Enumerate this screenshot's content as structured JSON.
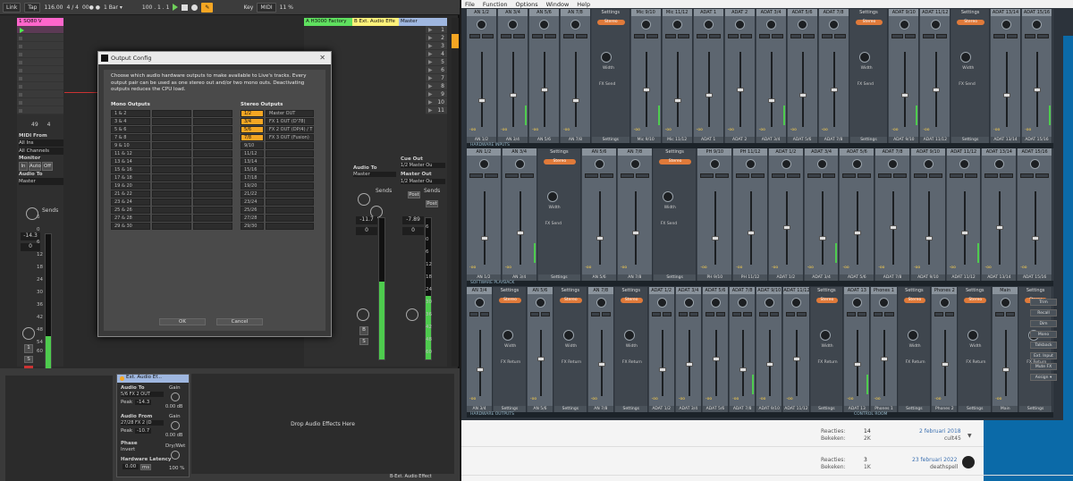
{
  "ableton": {
    "toolbar": {
      "link": "Link",
      "tap": "Tap",
      "bpm": "116.00",
      "meter": "4 / 4",
      "metro": "00● ●",
      "quantize": "1 Bar ▾",
      "position": "100 .  1 .  1",
      "key": "Key",
      "midi": "MIDI",
      "cpu": "11 %"
    },
    "tracks": [
      {
        "name": "1 SQ80 V",
        "color": "#ff66cc"
      },
      {
        "name": "A H3000 Factory",
        "color": "#5fe05f"
      },
      {
        "name": "B Ext. Audio Effe",
        "color": "#fff27a"
      },
      {
        "name": "Master",
        "color": "#9fb7e0"
      }
    ],
    "scenes": [
      "1",
      "2",
      "3",
      "4",
      "5",
      "6",
      "7",
      "8",
      "9",
      "10",
      "11"
    ],
    "io": {
      "midi_from": "MIDI From",
      "all_ins": "All Ins",
      "all_channels": "All Channels",
      "monitor": "Monitor",
      "mon_in": "In",
      "mon_auto": "Auto",
      "mon_off": "Off",
      "audio_to": "Audio To",
      "master": "Master",
      "sends": "Sends",
      "cue_out": "Cue Out",
      "cue_out_val": "1/2 Master Ou",
      "master_out": "Master Out",
      "master_out_val": "1/2 Master Ou",
      "post": "Post"
    },
    "volumes": {
      "t1": "-14.3",
      "t1b": "0",
      "a": "-11.7",
      "ab": "0",
      "m": "-7.89",
      "mb": "0"
    },
    "meter_ticks": [
      "6",
      "0",
      "6",
      "12",
      "18",
      "24",
      "30",
      "36",
      "42",
      "48",
      "54",
      "60"
    ],
    "track_buttons": {
      "t1_num": "1",
      "t1_s": "S",
      "ta": "A",
      "tb": "B"
    },
    "clip_counters": {
      "a": "49",
      "b": "4"
    },
    "device": {
      "title": "Ext. Audio Ef...",
      "audio_to": "Audio To",
      "audio_to_val": "5/6 FX 2 OUT",
      "gain": "Gain",
      "gain_val1": "0.00 dB",
      "peak": "Peak",
      "peak_val1": "-14.3",
      "audio_from": "Audio From",
      "audio_from_val": "27/28 FX 2 (D",
      "gain_val2": "0.00 dB",
      "peak_val2": "-10.7",
      "phase": "Phase",
      "invert": "Invert",
      "drywet": "Dry/Wet",
      "latency": "Hardware Latency",
      "latency_val": "0.00",
      "ms": "ms",
      "drywet_val": "100 %",
      "drop": "Drop Audio Effects Here",
      "bottom_tab": "B-Ext. Audio Effect"
    }
  },
  "dialog": {
    "title": "Output Config",
    "description": "Choose which audio hardware outputs to make available to Live's tracks. Every output pair can be used as one stereo out and/or two mono outs. Deactivating outputs reduces the CPU load.",
    "mono_header": "Mono Outputs",
    "stereo_header": "Stereo Outputs",
    "mono": [
      "1 & 2",
      "3 & 4",
      "5 & 6",
      "7 & 8",
      "9 & 10",
      "11 & 12",
      "13 & 14",
      "15 & 16",
      "17 & 18",
      "19 & 20",
      "21 & 22",
      "23 & 24",
      "25 & 26",
      "27 & 28",
      "29 & 30"
    ],
    "stereo": [
      {
        "pair": "1/2",
        "label": "Master OUT",
        "on": true
      },
      {
        "pair": "3/4",
        "label": "FX 1 OUT (D'78)",
        "on": true
      },
      {
        "pair": "5/6",
        "label": "FX 2 OUT (DP/4) / T",
        "on": true
      },
      {
        "pair": "7/8",
        "label": "FX 3 OUT (Fusion)",
        "on": true
      },
      {
        "pair": "9/10",
        "label": "",
        "on": false
      },
      {
        "pair": "11/12",
        "label": "",
        "on": false
      },
      {
        "pair": "13/14",
        "label": "",
        "on": false
      },
      {
        "pair": "15/16",
        "label": "",
        "on": false
      },
      {
        "pair": "17/18",
        "label": "",
        "on": false
      },
      {
        "pair": "19/20",
        "label": "",
        "on": false
      },
      {
        "pair": "21/22",
        "label": "",
        "on": false
      },
      {
        "pair": "23/24",
        "label": "",
        "on": false
      },
      {
        "pair": "25/26",
        "label": "",
        "on": false
      },
      {
        "pair": "27/28",
        "label": "",
        "on": false
      },
      {
        "pair": "29/30",
        "label": "",
        "on": false
      }
    ],
    "ok": "OK",
    "cancel": "Cancel"
  },
  "mixer": {
    "menu": [
      "File",
      "Function",
      "Options",
      "Window",
      "Help"
    ],
    "row1": [
      "AN 1/2",
      "AN 3/4",
      "AN 5/6",
      "AN 7/8",
      "Settings",
      "Mic 9/10",
      "Mic 11/12",
      "ADAT 1",
      "ADAT 2",
      "ADAT 3/4",
      "ADAT 5/6",
      "ADAT 7/8",
      "Settings",
      "ADAT 9/10",
      "ADAT 11/12",
      "Settings",
      "ADAT 13/14",
      "ADAT 15/16"
    ],
    "row2": [
      "AN 1/2",
      "AN 3/4",
      "Settings",
      "AN 5/6",
      "AN 7/8",
      "Settings",
      "PH 9/10",
      "PH 11/12",
      "ADAT 1/2",
      "ADAT 3/4",
      "ADAT 5/6",
      "ADAT 7/8",
      "ADAT 9/10",
      "ADAT 11/12",
      "ADAT 13/14",
      "ADAT 15/16"
    ],
    "row3": [
      "AN 3/4",
      "Settings",
      "AN 5/6",
      "Settings",
      "AN 7/8",
      "Settings",
      "ADAT 1/2",
      "ADAT 3/4",
      "ADAT 5/6",
      "ADAT 7/8",
      "ADAT 9/10",
      "ADAT 11/12",
      "Settings",
      "ADAT 13",
      "Phones 1",
      "Settings",
      "Phones 2",
      "Settings",
      "Main",
      "Settings"
    ],
    "labels": {
      "stereo": "Stereo",
      "inputs": "HARDWARE INPUTS",
      "playback": "SOFTWARE PLAYBACK",
      "outputs": "HARDWARE OUTPUTS",
      "control": "CONTROL ROOM",
      "fx_send": "FX Send",
      "fx_return": "FX Return",
      "talkback": "Talkback",
      "no_trim": "No Trim",
      "loopback": "Loopback",
      "width": "Width",
      "gain": "Gain",
      "level": "Level",
      "low": "Low",
      "high": "High",
      "db_in": "+4dBu",
      "minus_inf": "-oo"
    },
    "right_buttons": [
      "Trim",
      "Recall",
      "Dim",
      "Mono",
      "Talkback",
      "Ext. Input",
      "Mute FX",
      "Assign ▾"
    ]
  },
  "forum": {
    "rows": [
      {
        "reacties_label": "Reacties:",
        "reacties": "14",
        "bekeken_label": "Bekeken:",
        "bekeken": "2K",
        "date": "2 februari 2018",
        "user": "cult45"
      },
      {
        "reacties_label": "Reacties:",
        "reacties": "3",
        "bekeken_label": "Bekeken:",
        "bekeken": "1K",
        "date": "23 februari 2022",
        "user": "deathspell"
      }
    ]
  }
}
